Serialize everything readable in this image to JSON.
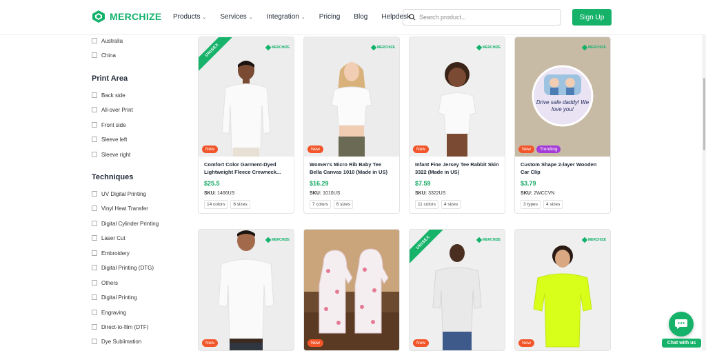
{
  "header": {
    "logo_text": "MERCHIZE",
    "nav": [
      {
        "label": "Products",
        "has_caret": true
      },
      {
        "label": "Services",
        "has_caret": true
      },
      {
        "label": "Integration",
        "has_caret": true
      },
      {
        "label": "Pricing",
        "has_caret": false
      },
      {
        "label": "Blog",
        "has_caret": false
      },
      {
        "label": "Helpdesk",
        "has_caret": false
      }
    ],
    "search_placeholder": "Search product...",
    "signup_label": "Sign Up"
  },
  "sidebar": {
    "location_items": [
      "Australia",
      "China"
    ],
    "print_area_title": "Print Area",
    "print_area_items": [
      "Back side",
      "All-over Print",
      "Front side",
      "Sleeve left",
      "Sleeve right"
    ],
    "techniques_title": "Techniques",
    "techniques_items": [
      "UV Digital Printing",
      "Vinyl Heat Transfer",
      "Digital Cylinder Printing",
      "Laser Cut",
      "Embroidery",
      "Digital Printing (DTG)",
      "Others",
      "Digital Printing",
      "Engraving",
      "Direct-to-film (DTF)",
      "Dye Sublimation"
    ]
  },
  "brand_watermark": "MERCHIZE",
  "products": [
    {
      "title": "Comfort Color Garment-Dyed Lightweight Fleece Crewneck...",
      "price": "$25.5",
      "sku_label": "SKU:",
      "sku": "1466US",
      "tags": [
        "14 colors",
        "6 sizes"
      ],
      "badges": [
        "New"
      ],
      "ribbon": "UNISEX"
    },
    {
      "title": "Women's Micro Rib Baby Tee Bella Canvas 1010 (Made in US)",
      "price": "$16.29",
      "sku_label": "SKU:",
      "sku": "1010US",
      "tags": [
        "7 colors",
        "6 sizes"
      ],
      "badges": [
        "New"
      ],
      "ribbon": ""
    },
    {
      "title": "Infant Fine Jersey Tee Rabbit Skin 3322 (Made in US)",
      "price": "$7.59",
      "sku_label": "SKU:",
      "sku": "3322US",
      "tags": [
        "11 colors",
        "4 sizes"
      ],
      "badges": [
        "New"
      ],
      "ribbon": ""
    },
    {
      "title": "Custom Shape 2-layer Wooden Car Clip",
      "price": "$3.79",
      "sku_label": "SKU:",
      "sku": "2WCCVN",
      "tags": [
        "3 types",
        "4 sizes"
      ],
      "badges": [
        "New",
        "Trending"
      ],
      "ribbon": "",
      "image_text": "Drive safe daddy! We love you!"
    },
    {
      "badges": [
        "New"
      ],
      "ribbon": ""
    },
    {
      "badges": [
        "New"
      ],
      "ribbon": ""
    },
    {
      "badges": [
        "New"
      ],
      "ribbon": "UNISEX"
    },
    {
      "badges": [
        "New"
      ],
      "ribbon": ""
    }
  ],
  "chat": {
    "label": "Chat with us"
  },
  "colors": {
    "brand_green": "#16b26a",
    "badge_new": "#f25529",
    "badge_trending": "#a53cd9",
    "price_green": "#11a762"
  }
}
